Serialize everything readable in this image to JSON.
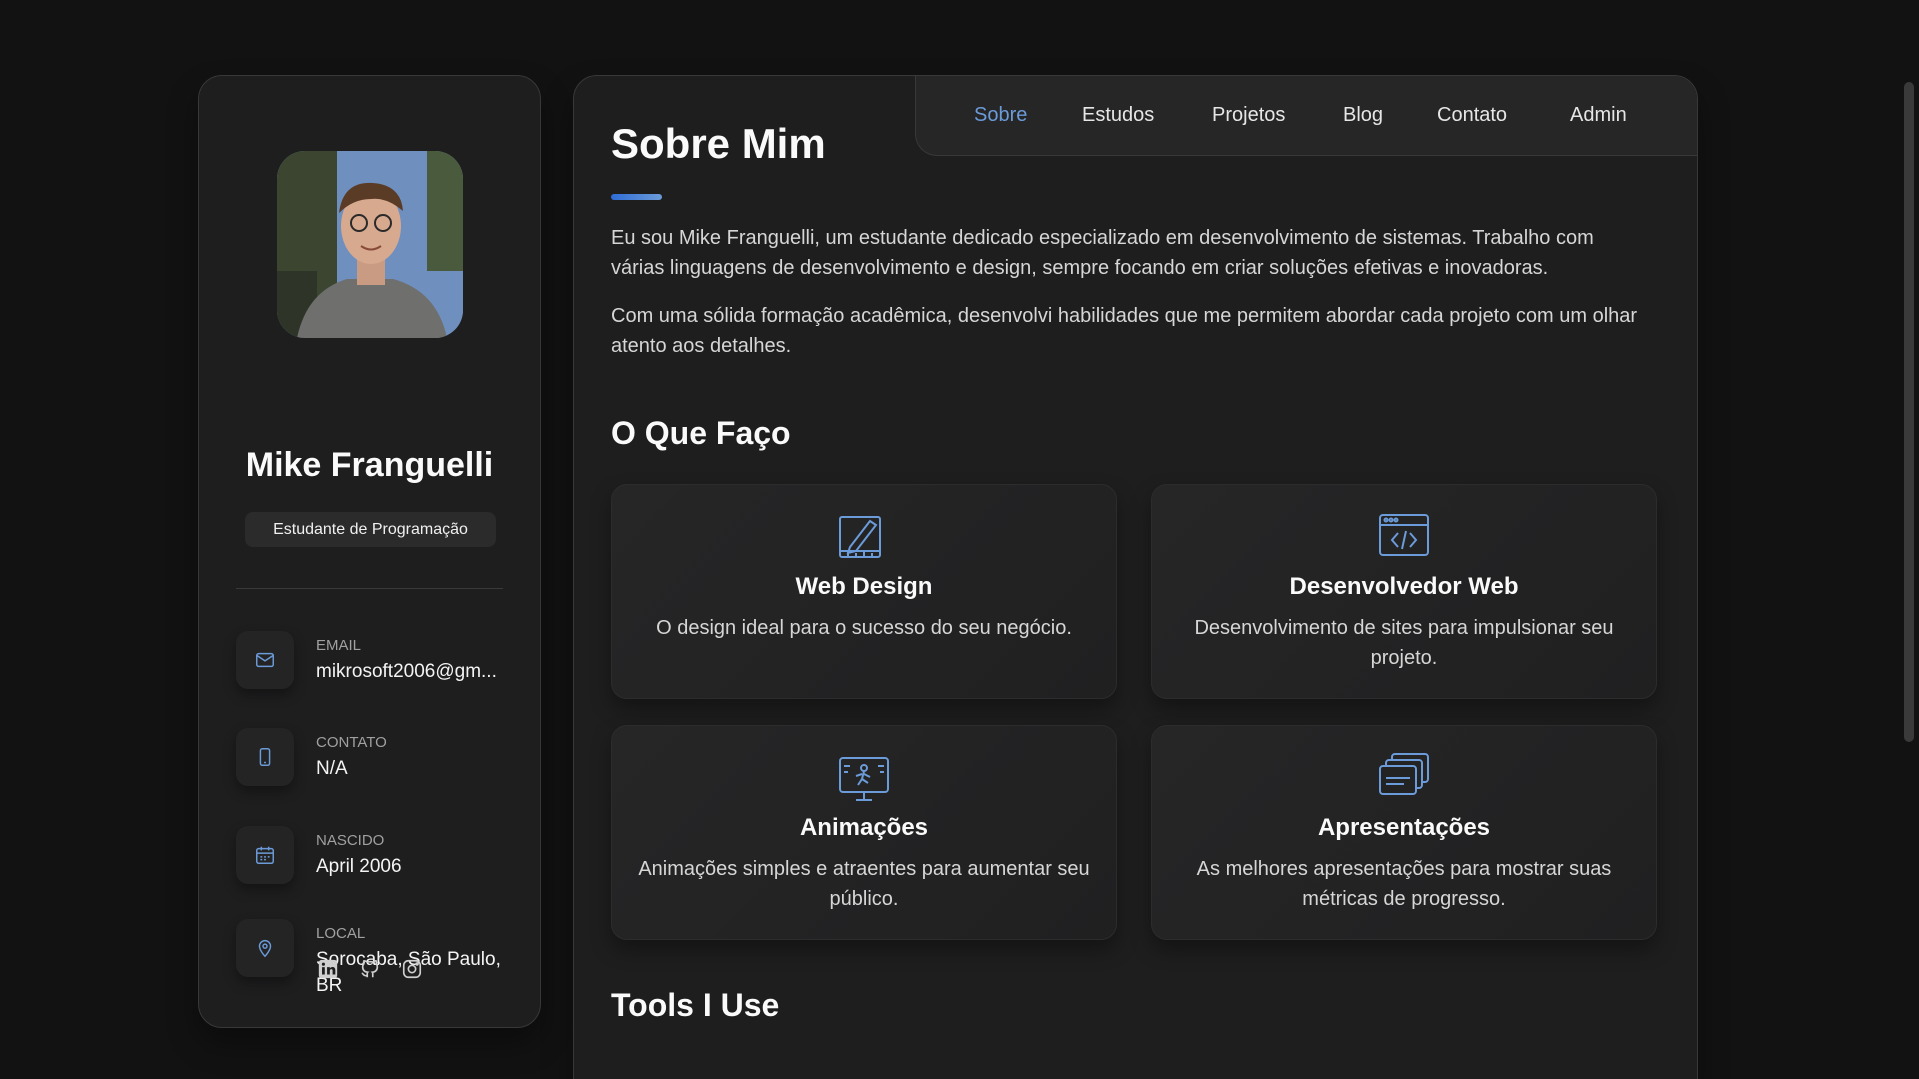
{
  "colors": {
    "accent": "#6b9bd8",
    "background": "#121212",
    "card": "#1e1e1f"
  },
  "sidebar": {
    "name": "Mike Franguelli",
    "role": "Estudante de Programação",
    "avatar_icon": "profile-photo",
    "contacts": [
      {
        "icon": "mail-icon",
        "label": "EMAIL",
        "value": "mikrosoft2006@gm..."
      },
      {
        "icon": "phone-icon",
        "label": "CONTATO",
        "value": "N/A"
      },
      {
        "icon": "calendar-icon",
        "label": "NASCIDO",
        "value": "April 2006"
      },
      {
        "icon": "map-pin-icon",
        "label": "LOCAL",
        "value": "Sorocaba, São Paulo, BR"
      }
    ],
    "socials": [
      "linkedin-icon",
      "github-icon",
      "instagram-icon"
    ]
  },
  "nav": {
    "items": [
      {
        "label": "Sobre",
        "active": true
      },
      {
        "label": "Estudos",
        "active": false
      },
      {
        "label": "Projetos",
        "active": false
      },
      {
        "label": "Blog",
        "active": false
      },
      {
        "label": "Contato",
        "active": false
      },
      {
        "label": "Admin",
        "active": false
      }
    ]
  },
  "about": {
    "title": "Sobre Mim",
    "paragraphs": [
      "Eu sou Mike Franguelli, um estudante dedicado especializado em desenvolvimento de sistemas. Trabalho com várias linguagens de desenvolvimento e design, sempre focando em criar soluções efetivas e inovadoras.",
      "Com uma sólida formação acadêmica, desenvolvi habilidades que me permitem abordar cada projeto com um olhar atento aos detalhes."
    ]
  },
  "services": {
    "title": "O Que Faço",
    "cards": [
      {
        "icon": "design-pencil-icon",
        "title": "Web Design",
        "text": "O design ideal para o sucesso do seu negócio."
      },
      {
        "icon": "code-window-icon",
        "title": "Desenvolvedor Web",
        "text": "Desenvolvimento de sites para impulsionar seu projeto."
      },
      {
        "icon": "animation-monitor-icon",
        "title": "Animações",
        "text": "Animações simples e atraentes para aumentar seu público."
      },
      {
        "icon": "presentation-slides-icon",
        "title": "Apresentações",
        "text": "As melhores apresentações para mostrar suas métricas de progresso."
      }
    ]
  },
  "tools": {
    "title": "Tools I Use"
  }
}
